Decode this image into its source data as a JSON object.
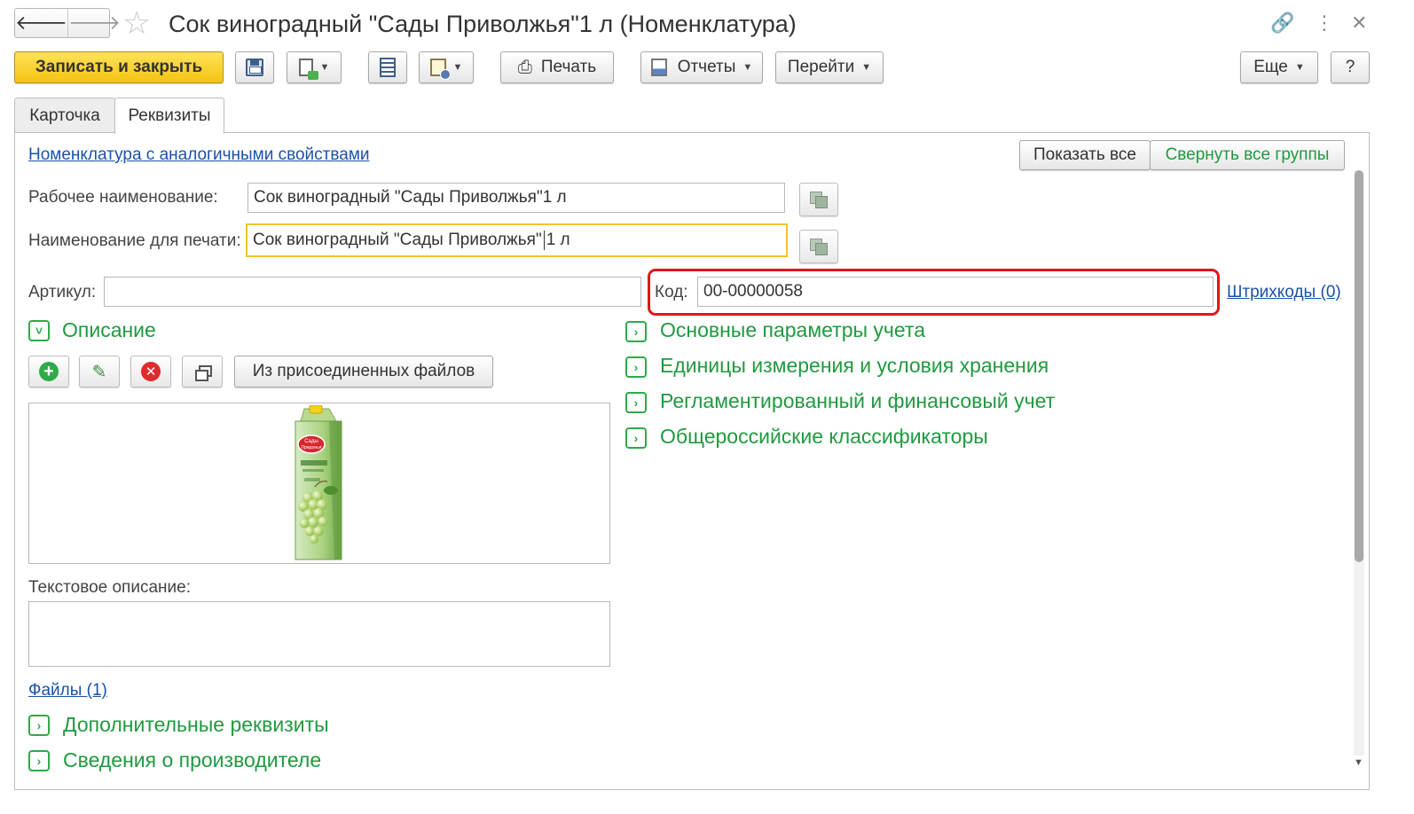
{
  "window": {
    "title": "Сок виноградный \"Сады Приволжья\"1 л (Номенклатура)",
    "nav_back": "🡐",
    "nav_forward": "🡒",
    "star": "☆",
    "link_icon": "🔗",
    "more_icon": "⋮",
    "close_icon": "✕"
  },
  "toolbar": {
    "save_close": "Записать и закрыть",
    "print": "Печать",
    "reports": "Отчеты",
    "goto": "Перейти",
    "more": "Еще",
    "help": "?"
  },
  "tabs": [
    {
      "label": "Карточка"
    },
    {
      "label": "Реквизиты"
    }
  ],
  "top_link": "Номенклатура с аналогичными свойствами",
  "buttons": {
    "show_all": "Показать все",
    "collapse_groups": "Свернуть все группы",
    "from_files": "Из присоединенных файлов"
  },
  "fields": {
    "work_name_label": "Рабочее наименование:",
    "work_name_value": "Сок виноградный \"Сады Приволжья\"1 л",
    "print_name_label": "Наименование для печати:",
    "print_name_value_before": "Сок виноградный \"Сады Приволжья\"",
    "print_name_value_after": "1 л",
    "article_label": "Артикул:",
    "article_value": "",
    "code_label": "Код:",
    "code_value": "00-00000058",
    "barcodes_link": "Штрихкоды (0)"
  },
  "groups": {
    "description": "Описание",
    "accounting": "Основные параметры учета",
    "units": "Единицы измерения и условия хранения",
    "regulated": "Регламентированный и финансовый учет",
    "classifiers": "Общероссийские классификаторы",
    "extra": "Дополнительные реквизиты",
    "producer": "Сведения о производителе"
  },
  "description": {
    "text_label": "Текстовое описание:",
    "files_link": "Файлы (1)",
    "package_brand_line1": "Сады",
    "package_brand_line2": "Придонья"
  },
  "colors": {
    "accent_yellow": "#f4c310",
    "group_green": "#1f9a3f",
    "link_blue": "#1a52a8",
    "highlight_red": "#e0161b"
  }
}
